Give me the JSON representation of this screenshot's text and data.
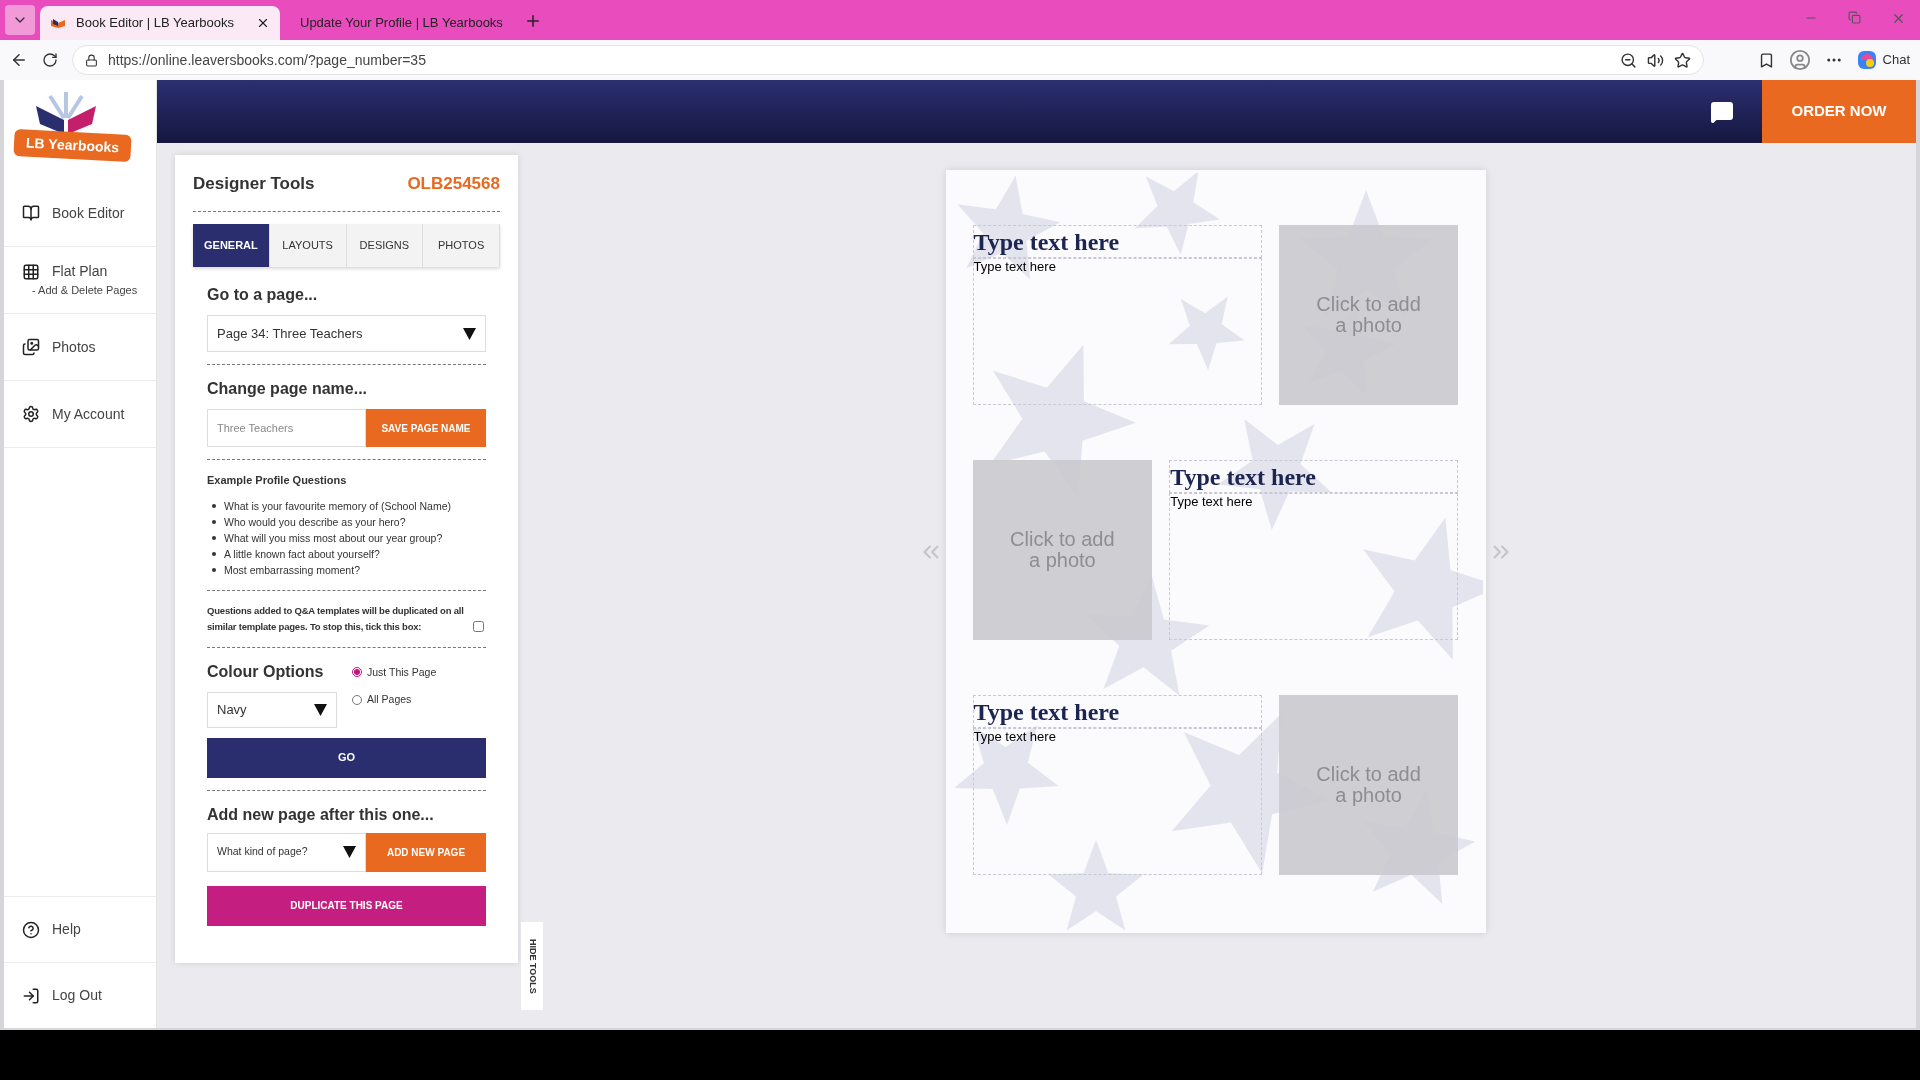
{
  "browser": {
    "tabs": [
      {
        "title": "Book Editor | LB Yearbooks",
        "selected": true
      },
      {
        "title": "Update Your Profile | LB Yearbooks",
        "selected": false
      }
    ],
    "url": "https://online.leaversbooks.com/?page_number=35",
    "chat_label": "Chat"
  },
  "logo": {
    "text": "LB Yearbooks"
  },
  "sidebar": {
    "items": [
      {
        "label": "Book Editor"
      },
      {
        "label": "Flat Plan",
        "sublabel": "- Add & Delete Pages"
      },
      {
        "label": "Photos"
      },
      {
        "label": "My Account"
      }
    ],
    "bottom_items": [
      {
        "label": "Help"
      },
      {
        "label": "Log Out"
      }
    ]
  },
  "header": {
    "order_button": "ORDER NOW"
  },
  "tools": {
    "title": "Designer Tools",
    "code": "OLB254568",
    "tabs": [
      {
        "label": "GENERAL",
        "selected": true
      },
      {
        "label": "LAYOUTS",
        "selected": false
      },
      {
        "label": "DESIGNS",
        "selected": false
      },
      {
        "label": "PHOTOS",
        "selected": false
      }
    ],
    "goto": {
      "heading": "Go to a page...",
      "value": "Page 34: Three Teachers"
    },
    "rename": {
      "heading": "Change page name...",
      "placeholder": "Three Teachers",
      "button": "SAVE PAGE NAME"
    },
    "questions": {
      "heading": "Example Profile Questions",
      "items": [
        "What is your favourite memory of (School Name)",
        "Who would you describe as your hero?",
        "What will you miss most about our year group?",
        "A little known fact about yourself?",
        "Most embarrassing moment?"
      ]
    },
    "note": {
      "text": "Questions added to Q&A templates will be duplicated on all similar template pages. To stop this, tick this box:",
      "checked": false
    },
    "colour": {
      "heading": "Colour Options",
      "value": "Navy",
      "options": [
        {
          "label": "Just This Page",
          "selected": true
        },
        {
          "label": "All Pages",
          "selected": false
        }
      ],
      "button": "GO"
    },
    "add_page": {
      "heading": "Add new page after this one...",
      "value": "What kind of page?",
      "button": "ADD NEW PAGE"
    },
    "duplicate_button": "DUPLICATE THIS PAGE",
    "hide_tab": "HIDE TOOLS"
  },
  "page": {
    "blocks": [
      {
        "kind": "text-photo",
        "heading": "Type text here",
        "body": "Type text here",
        "photo": "Click to add a photo"
      },
      {
        "kind": "photo-text",
        "heading": "Type text here",
        "body": "Type text here",
        "photo": "Click to add a photo"
      },
      {
        "kind": "text-photo",
        "heading": "Type text here",
        "body": "Type text here",
        "photo": "Click to add a photo"
      }
    ]
  }
}
